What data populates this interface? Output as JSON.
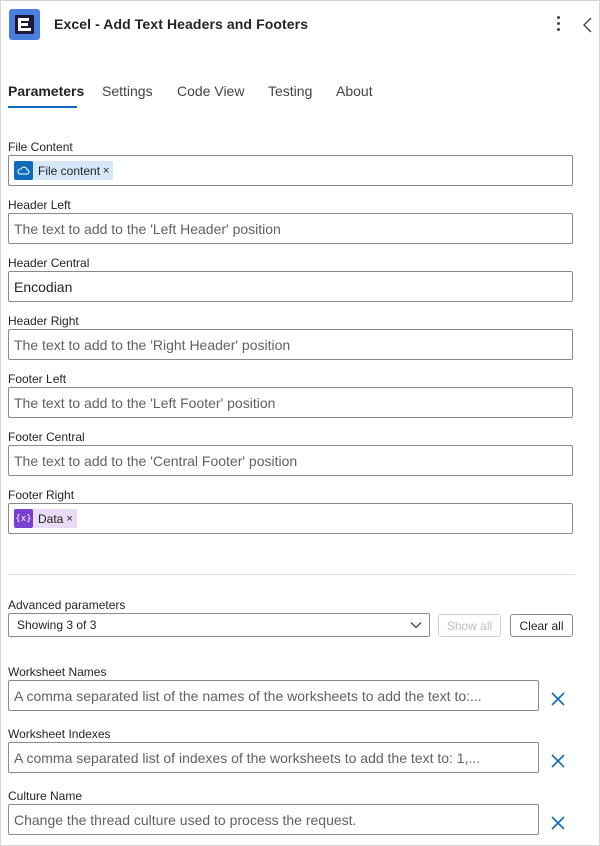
{
  "header": {
    "title": "Excel - Add Text Headers and Footers",
    "logo_icon": "encodian-logo",
    "more_icon": "more-vertical-icon",
    "collapse_icon": "chevron-left-icon"
  },
  "tabs": [
    {
      "label": "Parameters",
      "active": true
    },
    {
      "label": "Settings"
    },
    {
      "label": "Code View"
    },
    {
      "label": "Testing"
    },
    {
      "label": "About"
    }
  ],
  "fields": {
    "file_content": {
      "label": "File Content",
      "token": {
        "label": "File content",
        "close": "×",
        "icon": "onedrive-cloud-icon",
        "color": "#0f6cbd",
        "bg": "#d6e7f7"
      }
    },
    "header_left": {
      "label": "Header Left",
      "placeholder": "The text to add to the 'Left Header' position"
    },
    "header_central": {
      "label": "Header Central",
      "value": "Encodian"
    },
    "header_right": {
      "label": "Header Right",
      "placeholder": "The text to add to the 'Right Header' position"
    },
    "footer_left": {
      "label": "Footer Left",
      "placeholder": "The text to add to the 'Left Footer' position"
    },
    "footer_central": {
      "label": "Footer Central",
      "placeholder": "The text to add to the 'Central Footer' position"
    },
    "footer_right": {
      "label": "Footer Right",
      "token": {
        "label": "Data",
        "close": "×",
        "icon": "variable-icon",
        "icon_text": "{x}",
        "color": "#7a3fd0",
        "bg": "#eadbf7"
      }
    }
  },
  "advanced": {
    "label": "Advanced parameters",
    "select_value": "Showing 3 of 3",
    "show_all": "Show all",
    "clear_all": "Clear all"
  },
  "advanced_fields": {
    "worksheet_names": {
      "label": "Worksheet Names",
      "placeholder": "A comma separated list of the names of the worksheets to add the text to:..."
    },
    "worksheet_indexes": {
      "label": "Worksheet Indexes",
      "placeholder": "A comma separated list of indexes of the worksheets to add the text to: 1,..."
    },
    "culture_name": {
      "label": "Culture Name",
      "placeholder": "Change the thread culture used to process the request."
    }
  },
  "colors": {
    "accent": "#0f6cbd",
    "remove_x": "#0f6cbd"
  }
}
